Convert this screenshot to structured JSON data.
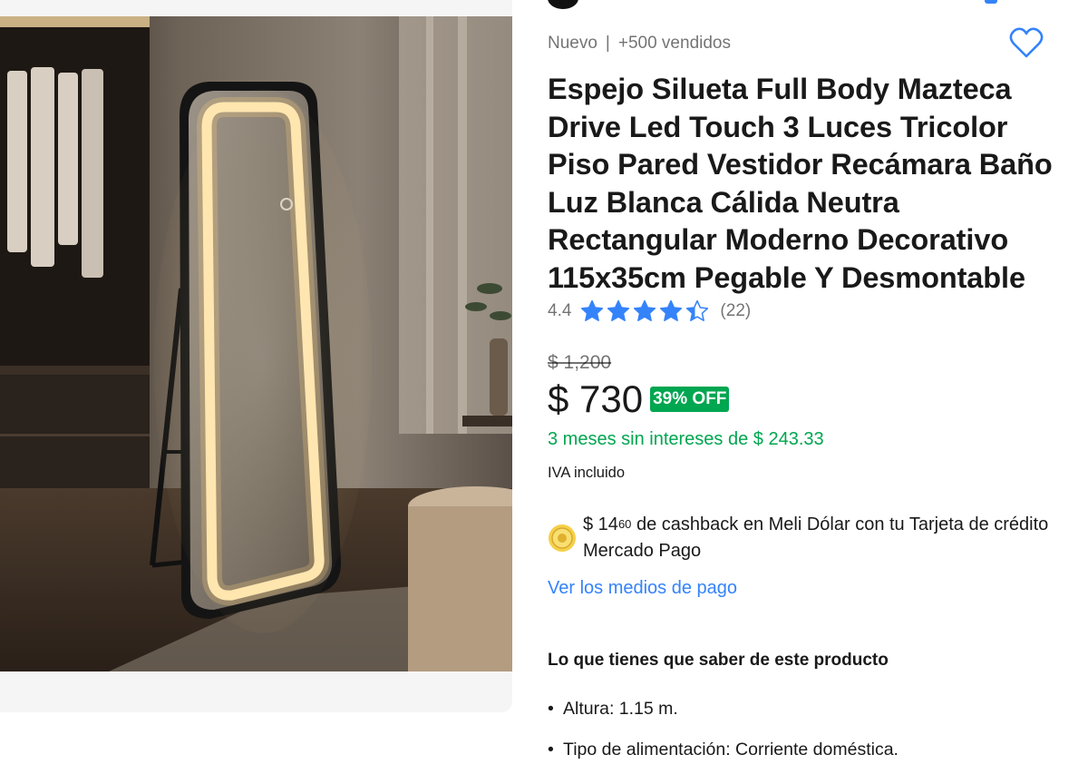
{
  "product": {
    "condition": "Nuevo",
    "separator": "|",
    "sold": "+500 vendidos",
    "title": "Espejo Silueta Full Body Mazteca Drive Led Touch 3 Luces Tricolor Piso Pared Vestidor Recámara Baño Luz Blanca Cálida Neutra Rectangular Moderno Decorativo 115x35cm Pegable Y Desmontable",
    "favorite_icon": "heart-outline-icon",
    "image_alt": "Espejo LED de cuerpo completo en vestidor"
  },
  "rating": {
    "average": "4.4",
    "stars": 4.4,
    "count": "(22)"
  },
  "pricing": {
    "original": "$ 1,200",
    "current": "$ 730",
    "discount": "39% OFF",
    "installments": "3 meses sin intereses de $ 243.33",
    "tax_note": "IVA incluido"
  },
  "cashback": {
    "amount": "$ 14",
    "cents": "60",
    "text": " de cashback en Meli Dólar con tu Tarjeta de crédito Mercado Pago",
    "icon": "meli-dolar-coin-icon"
  },
  "payment_link": "Ver los medios de pago",
  "highlights": {
    "title": "Lo que tienes que saber de este producto",
    "items": [
      "Altura: 1.15 m.",
      "Tipo de alimentación: Corriente doméstica."
    ]
  },
  "colors": {
    "accent_blue": "#3483fa",
    "discount_green": "#00a650",
    "star_blue": "#3483fa"
  }
}
